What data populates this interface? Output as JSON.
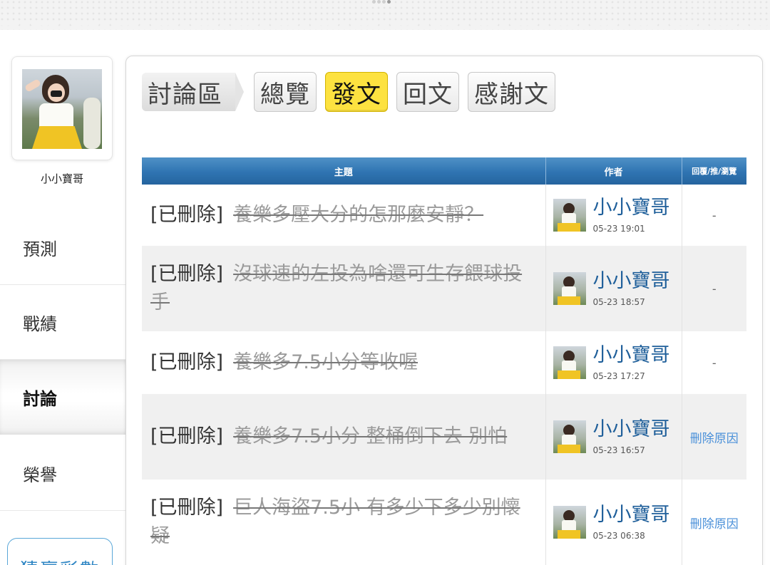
{
  "sidebar": {
    "username": "小小寶哥",
    "nav": [
      "預測",
      "戰績",
      "討論",
      "榮譽"
    ],
    "active": "討論",
    "cta_label": "猜贏彩數"
  },
  "main": {
    "breadcrumb": "討論區",
    "tabs": [
      "總覽",
      "發文",
      "回文",
      "感謝文"
    ],
    "active_tab": "發文"
  },
  "table": {
    "headers": [
      "主題",
      "作者",
      "回覆/推/瀏覽"
    ],
    "rows": [
      {
        "tag": "[已刪除]",
        "title": "養樂多壓大分的怎那麼安靜？",
        "author": "小小寶哥",
        "time": "05-23 19:01",
        "stat": "-"
      },
      {
        "tag": "[已刪除]",
        "title": "沒球速的左投為啥還可生存餵球投手",
        "author": "小小寶哥",
        "time": "05-23 18:57",
        "stat": "-"
      },
      {
        "tag": "[已刪除]",
        "title": "養樂多7.5小分等收喔",
        "author": "小小寶哥",
        "time": "05-23 17:27",
        "stat": "-"
      },
      {
        "tag": "[已刪除]",
        "title": "養樂多7.5小分 整桶倒下去 別怕",
        "author": "小小寶哥",
        "time": "05-23 16:57",
        "stat": "刪除原因"
      },
      {
        "tag": "[已刪除]",
        "title": "巨人海盜7.5小 有多少下多少別懷疑",
        "author": "小小寶哥",
        "time": "05-23 06:38",
        "stat": "刪除原因"
      }
    ]
  },
  "colors": {
    "header_blue": "#2f74b2",
    "active_tab_yellow": "#fde240",
    "author_link": "#1f5f9a",
    "reason_link": "#4a90d9"
  },
  "icons": {
    "avatar": "user-photo",
    "author_thumb": "user-photo-thumb"
  }
}
